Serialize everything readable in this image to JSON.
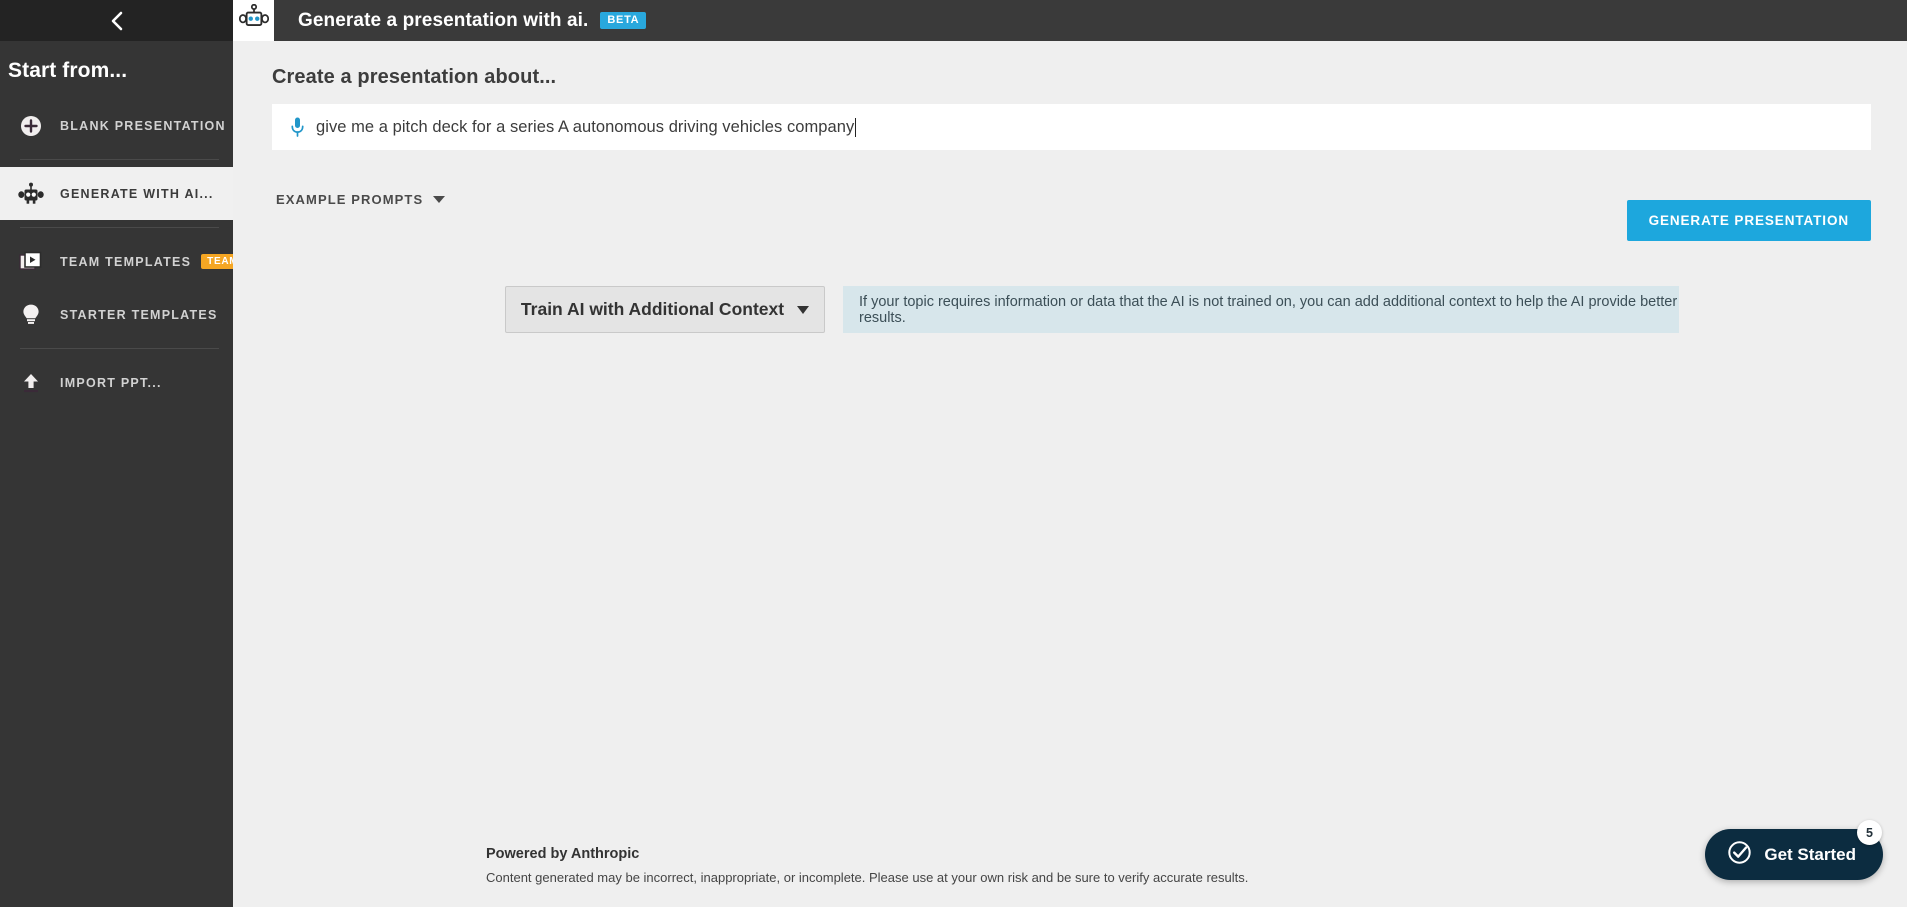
{
  "sidebar": {
    "back_icon": "chevron-left-icon",
    "heading": "Start from...",
    "items": [
      {
        "label": "Blank Presentation",
        "icon": "plus-circle-icon",
        "active": false,
        "badge": null
      },
      {
        "label": "Generate with AI...",
        "icon": "robot-icon",
        "active": true,
        "badge": null
      },
      {
        "label": "Team Templates",
        "icon": "slides-play-icon",
        "active": false,
        "badge": "TEAM"
      },
      {
        "label": "Starter Templates",
        "icon": "lightbulb-icon",
        "active": false,
        "badge": null
      },
      {
        "label": "Import PPT...",
        "icon": "upload-icon",
        "active": false,
        "badge": null
      }
    ],
    "team_badge_color": "#f5a623"
  },
  "header": {
    "icon": "robot-icon",
    "title": "Generate a presentation with ai.",
    "badge": "BETA",
    "badge_color": "#29a8dd",
    "background": "#3a3a3a"
  },
  "main": {
    "section_title": "Create a presentation about...",
    "prompt": {
      "icon": "microphone-icon",
      "value": "give me a pitch deck for a series A autonomous driving vehicles company",
      "placeholder": "Create a presentation about...",
      "icon_color": "#2196c9"
    },
    "example_prompts": {
      "label": "Example Prompts",
      "caret_icon": "chevron-down-icon"
    },
    "generate_button": {
      "label": "Generate Presentation",
      "color": "#1da7dd"
    },
    "context": {
      "button_label": "Train AI with Additional Context",
      "button_caret_icon": "chevron-down-icon",
      "banner_text": "If your topic requires information or data that the AI is not trained on, you can add additional context to help the AI provide better results.",
      "banner_color": "#d7e6eb"
    }
  },
  "footer": {
    "title": "Powered by Anthropic",
    "note": "Content generated may be incorrect, inappropriate, or incomplete. Please use at your own risk and be sure to verify accurate results."
  },
  "get_started": {
    "label": "Get Started",
    "icon": "check-circle-icon",
    "badge_count": "5",
    "color": "#0c2c40"
  }
}
